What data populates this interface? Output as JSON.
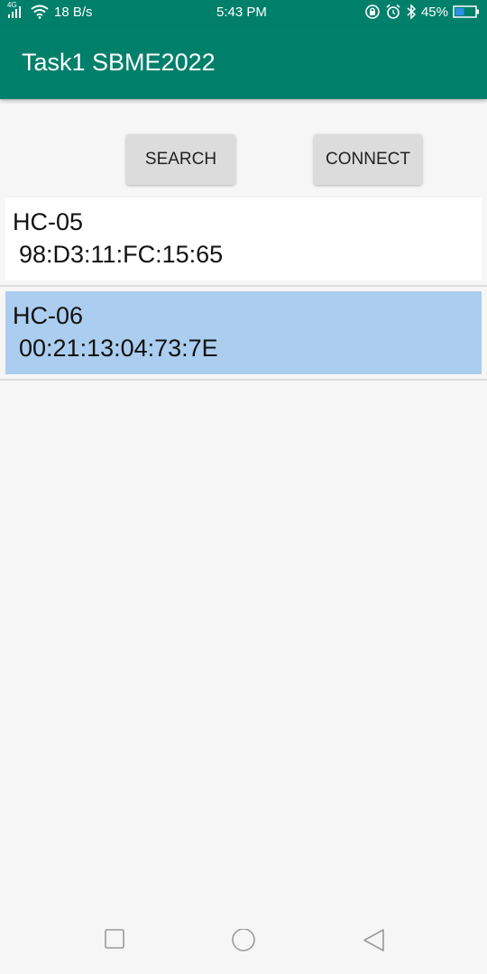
{
  "status_bar": {
    "signal_label": "4G",
    "network_speed": "18 B/s",
    "time": "5:43 PM",
    "battery_percent": "45%",
    "battery_level": 0.45,
    "icons": [
      "signal-icon",
      "wifi-icon",
      "rotation-lock-icon",
      "alarm-icon",
      "bluetooth-icon",
      "battery-icon"
    ]
  },
  "app_bar": {
    "title": "Task1 SBME2022",
    "color": "#00806b"
  },
  "toolbar": {
    "search_label": "SEARCH",
    "connect_label": "CONNECT"
  },
  "devices": [
    {
      "name": "HC-05",
      "address": " 98:D3:11:FC:15:65",
      "selected": false
    },
    {
      "name": "HC-06",
      "address": " 00:21:13:04:73:7E",
      "selected": true
    }
  ],
  "colors": {
    "selected_row": "#abcdef",
    "background": "#f6f6f6"
  },
  "nav_bar": {
    "icons": [
      "recent-apps-icon",
      "home-icon",
      "back-icon"
    ]
  }
}
